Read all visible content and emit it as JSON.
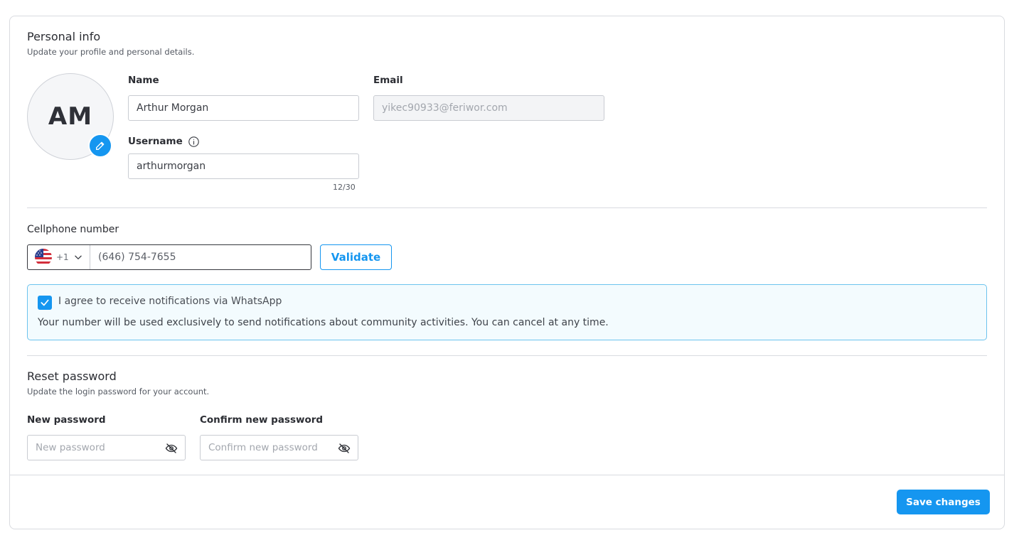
{
  "personal": {
    "title": "Personal info",
    "subtitle": "Update your profile and personal details.",
    "avatar_initials": "AM",
    "name_label": "Name",
    "name_value": "Arthur Morgan",
    "email_label": "Email",
    "email_value": "yikec90933@feriwor.com",
    "username_label": "Username",
    "username_value": "arthurmorgan",
    "username_counter": "12/30"
  },
  "phone": {
    "label": "Cellphone number",
    "country_code": "+1",
    "country_flag": "us-flag-icon",
    "number": "(646) 754-7655",
    "validate_label": "Validate"
  },
  "whatsapp": {
    "checked": true,
    "consent_label": "I agree to receive notifications via WhatsApp",
    "description": "Your number will be used exclusively to send notifications about community activities. You can cancel at any time."
  },
  "password": {
    "title": "Reset password",
    "subtitle": "Update the login password for your account.",
    "new_label": "New password",
    "new_placeholder": "New password",
    "confirm_label": "Confirm new password",
    "confirm_placeholder": "Confirm new password"
  },
  "footer": {
    "save_label": "Save changes"
  },
  "colors": {
    "accent": "#1596f0",
    "notice_bg": "#f3fbfe",
    "notice_border": "#6cc3ee"
  }
}
